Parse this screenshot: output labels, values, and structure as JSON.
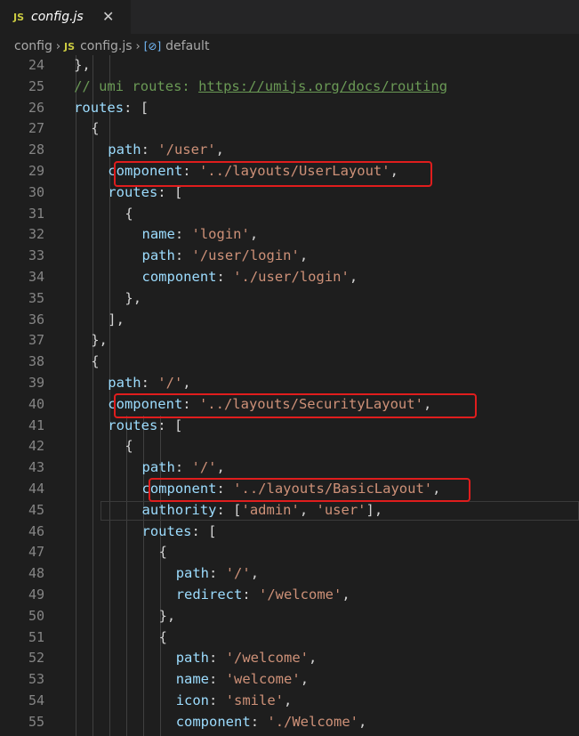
{
  "tab": {
    "badge": "JS",
    "title": "config.js",
    "close": "✕"
  },
  "breadcrumb": {
    "folder": "config",
    "file_badge": "JS",
    "file": "config.js",
    "symbol_icon": "[⊘]",
    "symbol": "default",
    "sep": "›"
  },
  "lines": [
    {
      "n": "24",
      "indent": 2,
      "tokens": [
        {
          "t": "},",
          "c": "p"
        }
      ]
    },
    {
      "n": "25",
      "indent": 2,
      "tokens": [
        {
          "t": "// umi routes: ",
          "c": "c"
        },
        {
          "t": "https://umijs.org/docs/routing",
          "c": "u"
        }
      ]
    },
    {
      "n": "26",
      "indent": 2,
      "tokens": [
        {
          "t": "routes",
          "c": "k"
        },
        {
          "t": ": [",
          "c": "p"
        }
      ]
    },
    {
      "n": "27",
      "indent": 4,
      "tokens": [
        {
          "t": "{",
          "c": "p"
        }
      ]
    },
    {
      "n": "28",
      "indent": 6,
      "tokens": [
        {
          "t": "path",
          "c": "k"
        },
        {
          "t": ": ",
          "c": "p"
        },
        {
          "t": "'/user'",
          "c": "s"
        },
        {
          "t": ",",
          "c": "p"
        }
      ]
    },
    {
      "n": "29",
      "indent": 6,
      "tokens": [
        {
          "t": "component",
          "c": "k"
        },
        {
          "t": ": ",
          "c": "p"
        },
        {
          "t": "'../layouts/UserLayout'",
          "c": "s"
        },
        {
          "t": ",",
          "c": "p"
        }
      ]
    },
    {
      "n": "30",
      "indent": 6,
      "tokens": [
        {
          "t": "routes",
          "c": "k"
        },
        {
          "t": ": [",
          "c": "p"
        }
      ]
    },
    {
      "n": "31",
      "indent": 8,
      "tokens": [
        {
          "t": "{",
          "c": "p"
        }
      ]
    },
    {
      "n": "32",
      "indent": 10,
      "tokens": [
        {
          "t": "name",
          "c": "k"
        },
        {
          "t": ": ",
          "c": "p"
        },
        {
          "t": "'login'",
          "c": "s"
        },
        {
          "t": ",",
          "c": "p"
        }
      ]
    },
    {
      "n": "33",
      "indent": 10,
      "tokens": [
        {
          "t": "path",
          "c": "k"
        },
        {
          "t": ": ",
          "c": "p"
        },
        {
          "t": "'/user/login'",
          "c": "s"
        },
        {
          "t": ",",
          "c": "p"
        }
      ]
    },
    {
      "n": "34",
      "indent": 10,
      "tokens": [
        {
          "t": "component",
          "c": "k"
        },
        {
          "t": ": ",
          "c": "p"
        },
        {
          "t": "'./user/login'",
          "c": "s"
        },
        {
          "t": ",",
          "c": "p"
        }
      ]
    },
    {
      "n": "35",
      "indent": 8,
      "tokens": [
        {
          "t": "},",
          "c": "p"
        }
      ]
    },
    {
      "n": "36",
      "indent": 6,
      "tokens": [
        {
          "t": "],",
          "c": "p"
        }
      ]
    },
    {
      "n": "37",
      "indent": 4,
      "tokens": [
        {
          "t": "},",
          "c": "p"
        }
      ]
    },
    {
      "n": "38",
      "indent": 4,
      "tokens": [
        {
          "t": "{",
          "c": "p"
        }
      ]
    },
    {
      "n": "39",
      "indent": 6,
      "tokens": [
        {
          "t": "path",
          "c": "k"
        },
        {
          "t": ": ",
          "c": "p"
        },
        {
          "t": "'/'",
          "c": "s"
        },
        {
          "t": ",",
          "c": "p"
        }
      ]
    },
    {
      "n": "40",
      "indent": 6,
      "tokens": [
        {
          "t": "component",
          "c": "k"
        },
        {
          "t": ": ",
          "c": "p"
        },
        {
          "t": "'../layouts/SecurityLayout'",
          "c": "s"
        },
        {
          "t": ",",
          "c": "p"
        }
      ]
    },
    {
      "n": "41",
      "indent": 6,
      "tokens": [
        {
          "t": "routes",
          "c": "k"
        },
        {
          "t": ": [",
          "c": "p"
        }
      ]
    },
    {
      "n": "42",
      "indent": 8,
      "tokens": [
        {
          "t": "{",
          "c": "p"
        }
      ]
    },
    {
      "n": "43",
      "indent": 10,
      "tokens": [
        {
          "t": "path",
          "c": "k"
        },
        {
          "t": ": ",
          "c": "p"
        },
        {
          "t": "'/'",
          "c": "s"
        },
        {
          "t": ",",
          "c": "p"
        }
      ]
    },
    {
      "n": "44",
      "indent": 10,
      "tokens": [
        {
          "t": "component",
          "c": "k"
        },
        {
          "t": ": ",
          "c": "p"
        },
        {
          "t": "'../layouts/BasicLayout'",
          "c": "s"
        },
        {
          "t": ",",
          "c": "p"
        }
      ]
    },
    {
      "n": "45",
      "indent": 10,
      "tokens": [
        {
          "t": "authority",
          "c": "k"
        },
        {
          "t": ": [",
          "c": "p"
        },
        {
          "t": "'admin'",
          "c": "s"
        },
        {
          "t": ", ",
          "c": "p"
        },
        {
          "t": "'user'",
          "c": "s"
        },
        {
          "t": "],",
          "c": "p"
        }
      ]
    },
    {
      "n": "46",
      "indent": 10,
      "tokens": [
        {
          "t": "routes",
          "c": "k"
        },
        {
          "t": ": [",
          "c": "p"
        }
      ]
    },
    {
      "n": "47",
      "indent": 12,
      "tokens": [
        {
          "t": "{",
          "c": "p"
        }
      ]
    },
    {
      "n": "48",
      "indent": 14,
      "tokens": [
        {
          "t": "path",
          "c": "k"
        },
        {
          "t": ": ",
          "c": "p"
        },
        {
          "t": "'/'",
          "c": "s"
        },
        {
          "t": ",",
          "c": "p"
        }
      ]
    },
    {
      "n": "49",
      "indent": 14,
      "tokens": [
        {
          "t": "redirect",
          "c": "k"
        },
        {
          "t": ": ",
          "c": "p"
        },
        {
          "t": "'/welcome'",
          "c": "s"
        },
        {
          "t": ",",
          "c": "p"
        }
      ]
    },
    {
      "n": "50",
      "indent": 12,
      "tokens": [
        {
          "t": "},",
          "c": "p"
        }
      ]
    },
    {
      "n": "51",
      "indent": 12,
      "tokens": [
        {
          "t": "{",
          "c": "p"
        }
      ]
    },
    {
      "n": "52",
      "indent": 14,
      "tokens": [
        {
          "t": "path",
          "c": "k"
        },
        {
          "t": ": ",
          "c": "p"
        },
        {
          "t": "'/welcome'",
          "c": "s"
        },
        {
          "t": ",",
          "c": "p"
        }
      ]
    },
    {
      "n": "53",
      "indent": 14,
      "tokens": [
        {
          "t": "name",
          "c": "k"
        },
        {
          "t": ": ",
          "c": "p"
        },
        {
          "t": "'welcome'",
          "c": "s"
        },
        {
          "t": ",",
          "c": "p"
        }
      ]
    },
    {
      "n": "54",
      "indent": 14,
      "tokens": [
        {
          "t": "icon",
          "c": "k"
        },
        {
          "t": ": ",
          "c": "p"
        },
        {
          "t": "'smile'",
          "c": "s"
        },
        {
          "t": ",",
          "c": "p"
        }
      ]
    },
    {
      "n": "55",
      "indent": 14,
      "tokens": [
        {
          "t": "component",
          "c": "k"
        },
        {
          "t": ": ",
          "c": "p"
        },
        {
          "t": "'./Welcome'",
          "c": "s"
        },
        {
          "t": ",",
          "c": "p"
        }
      ]
    }
  ]
}
